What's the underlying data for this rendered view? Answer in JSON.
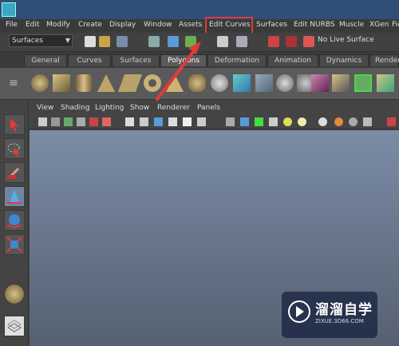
{
  "menubar": {
    "items": [
      "File",
      "Edit",
      "Modify",
      "Create",
      "Display",
      "Window",
      "Assets",
      "Edit Curves",
      "Surfaces",
      "Edit NURBS",
      "Muscle",
      "XGen",
      "Fie"
    ]
  },
  "status_line": {
    "mode_dropdown": "Surfaces",
    "live_surface": "No Live Surface"
  },
  "shelf_tabs": {
    "tabs": [
      "General",
      "Curves",
      "Surfaces",
      "Polygons",
      "Deformation",
      "Animation",
      "Dynamics",
      "Render"
    ],
    "active": "Polygons"
  },
  "panel": {
    "menu_items": [
      "View",
      "Shading",
      "Lighting",
      "Show",
      "Renderer",
      "Panels"
    ]
  },
  "watermark": {
    "title": "溜溜自学",
    "subtitle": "ZIXUE.3D66.COM"
  },
  "colors": {
    "highlight": "#e03a3a",
    "viewport_top": "#7b8ca6",
    "viewport_bottom": "#556172"
  },
  "icons": [
    "app-logo",
    "select-tool-icon",
    "lasso-tool-icon",
    "paint-select-icon",
    "move-tool-icon",
    "rotate-tool-icon",
    "scale-tool-icon",
    "sphere-icon",
    "layout-icon"
  ]
}
